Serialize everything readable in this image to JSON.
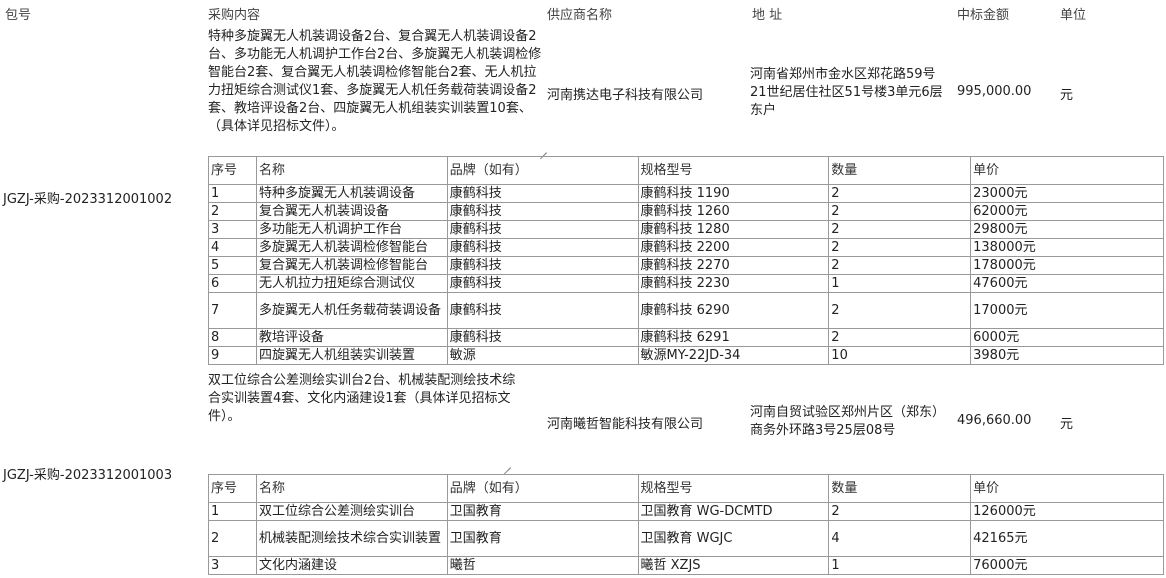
{
  "headers": {
    "pkg": "包号",
    "content": "采购内容",
    "supplier": "供应商名称",
    "address": "地 址",
    "amount": "中标金额",
    "unit": "单位"
  },
  "lots": [
    {
      "pkg_id": "JGZJ-采购-2023312001002",
      "description": "特种多旋翼无人机装调设备2台、复合翼无人机装调设备2台、多功能无人机调护工作台2台、多旋翼无人机装调检修智能台2套、复合翼无人机装调检修智能台2套、无人机拉力扭矩综合测试仪1套、多旋翼无人机任务载荷装调设备2套、教培评设备2台、四旋翼无人机组装实训装置10套、（具体详见招标文件）。",
      "supplier": "河南携达电子科技有限公司",
      "address": "河南省郑州市金水区郑花路59号21世纪居住社区51号楼3单元6层东户",
      "amount": "995,000.00",
      "unit": "元",
      "table_headers": [
        "序号",
        "名称",
        "品牌（如有）",
        "规格型号",
        "数量",
        "单价"
      ],
      "rows": [
        [
          "1",
          "特种多旋翼无人机装调设备",
          "康鹤科技",
          "康鹤科技 1190",
          "2",
          "23000元"
        ],
        [
          "2",
          "复合翼无人机装调设备",
          "康鹤科技",
          "康鹤科技 1260",
          "2",
          "62000元"
        ],
        [
          "3",
          "多功能无人机调护工作台",
          "康鹤科技",
          "康鹤科技 1280",
          "2",
          "29800元"
        ],
        [
          "4",
          "多旋翼无人机装调检修智能台",
          "康鹤科技",
          "康鹤科技 2200",
          "2",
          "138000元"
        ],
        [
          "5",
          "复合翼无人机装调检修智能台",
          "康鹤科技",
          "康鹤科技 2270",
          "2",
          "178000元"
        ],
        [
          "6",
          "无人机拉力扭矩综合测试仪",
          "康鹤科技",
          "康鹤科技 2230",
          "1",
          "47600元"
        ],
        [
          "7",
          "多旋翼无人机任务载荷装调设备",
          "康鹤科技",
          "康鹤科技 6290",
          "2",
          "17000元"
        ],
        [
          "8",
          "教培评设备",
          "康鹤科技",
          "康鹤科技 6291",
          "2",
          "6000元"
        ],
        [
          "9",
          "四旋翼无人机组装实训装置",
          "敏源",
          "敏源MY-22JD-34",
          "10",
          "3980元"
        ]
      ]
    },
    {
      "pkg_id": "JGZJ-采购-2023312001003",
      "description": "双工位综合公差测绘实训台2台、机械装配测绘技术综合实训装置4套、文化内涵建设1套（具体详见招标文件）。",
      "supplier": "河南曦哲智能科技有限公司",
      "address": "河南自贸试验区郑州片区（郑东）商务外环路3号25层08号",
      "amount": "496,660.00",
      "unit": "元",
      "table_headers": [
        "序号",
        "名称",
        "品牌（如有）",
        "规格型号",
        "数量",
        "单价"
      ],
      "rows": [
        [
          "1",
          "双工位综合公差测绘实训台",
          "卫国教育",
          "卫国教育 WG-DCMTD",
          "2",
          "126000元"
        ],
        [
          "2",
          "机械装配测绘技术综合实训装置",
          "卫国教育",
          "卫国教育 WGJC",
          "4",
          "42165元"
        ],
        [
          "3",
          "文化内涵建设",
          "曦哲",
          "曦哲 XZJS",
          "1",
          "76000元"
        ]
      ]
    }
  ]
}
